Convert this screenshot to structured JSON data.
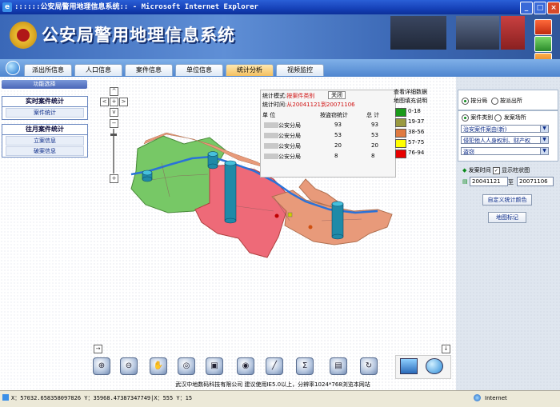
{
  "window": {
    "title": "::::::公安局警用地理信息系统:: - Microsoft Internet Explorer"
  },
  "header": {
    "title": "公安局警用地理信息系统"
  },
  "nav": {
    "tabs": [
      "派出所信息",
      "人口信息",
      "案件信息",
      "单位信息",
      "统计分析",
      "视频监控"
    ],
    "active": "统计分析"
  },
  "left": {
    "function_select": "功能选择",
    "groups": [
      {
        "title": "实时案件统计",
        "items": [
          "案件统计"
        ]
      },
      {
        "title": "往月案件统计",
        "items": [
          "立案信息",
          "破案信息"
        ]
      }
    ]
  },
  "stats": {
    "mode_label": "统计模式:",
    "mode_value": "按案件类别",
    "close": "关闭",
    "time_label": "统计时间:",
    "time_value": "从20041121到20071106",
    "headers": [
      "单  位",
      "按盗窃统计",
      "总  计"
    ],
    "rows": [
      {
        "unit": "公安分局",
        "value": "93",
        "total": "93"
      },
      {
        "unit": "公安分局",
        "value": "53",
        "total": "53"
      },
      {
        "unit": "公安分局",
        "value": "20",
        "total": "20"
      },
      {
        "unit": "公安分局",
        "value": "8",
        "total": "8"
      }
    ]
  },
  "legend": {
    "title1": "查看详细数据",
    "title2": "地图填充说明",
    "items": [
      {
        "label": "0-18",
        "color": "#1a9a1a"
      },
      {
        "label": "19-37",
        "color": "#9a9a40"
      },
      {
        "label": "38-56",
        "color": "#e07a40"
      },
      {
        "label": "57-75",
        "color": "#ffff00"
      },
      {
        "label": "76-94",
        "color": "#e80000"
      }
    ]
  },
  "right": {
    "scope_options": [
      "按分局",
      "按派出所"
    ],
    "scope_selected": "按分局",
    "type_options": [
      "案件类别",
      "发案场所"
    ],
    "type_selected": "案件类别",
    "selects": [
      "治安案件案由(新)",
      "侵犯他人人身权利、财产权",
      "盗窃"
    ],
    "time_label": "发案时间",
    "show_bar_label": "显示柱状图",
    "date_from": "20041121",
    "date_to_label": "至",
    "date_to": "20071106",
    "custom_color": "自定义统计颜色",
    "map_mark": "地图标记"
  },
  "map": {
    "regions": {
      "green": "#77c866",
      "red": "#ee6a78",
      "orange": "#e89a7a",
      "river": "#2a72d8"
    },
    "bars": [
      {
        "value": 93,
        "label": "公安分局"
      },
      {
        "value": 53,
        "label": "公安分局"
      },
      {
        "value": 20,
        "label": "公安分局"
      },
      {
        "value": 8,
        "label": "公安分局"
      }
    ]
  },
  "toolbar": {
    "icons": [
      "zoom-in-icon",
      "zoom-out-icon",
      "pan-hand-icon",
      "globe-icon",
      "print-icon",
      "eye-icon",
      "measure-icon",
      "sum-icon",
      "layer-icon",
      "refresh-icon"
    ]
  },
  "footer": {
    "text": "武汉中地数码科技有限公司  建议使用IE5.0以上，分辨率1024*768浏览本网站"
  },
  "status": {
    "coords": "X：57032.658358097826 Y：35968.47387347749|X：555 Y：15",
    "zone": "Internet"
  }
}
